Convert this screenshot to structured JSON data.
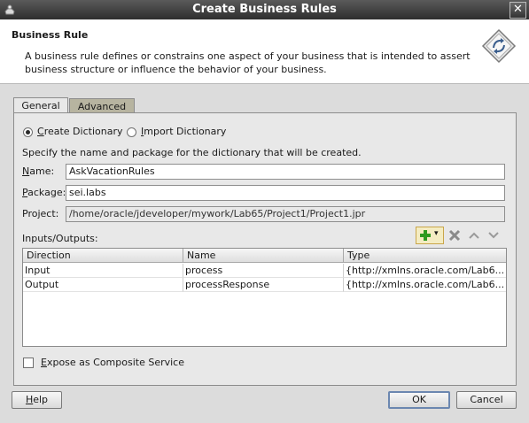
{
  "window": {
    "title": "Create Business Rules",
    "close_label": "✕"
  },
  "header": {
    "title": "Business Rule",
    "description": "A business rule defines or constrains one aspect of your business that is intended to assert business structure or influence the behavior of your business."
  },
  "tabs": [
    {
      "label": "General",
      "active": true
    },
    {
      "label": "Advanced",
      "active": false
    }
  ],
  "dictionary_mode": {
    "create_label": "Create Dictionary",
    "import_label": "Import Dictionary",
    "selected": "create"
  },
  "instructions": "Specify the name and package for the dictionary that will be created.",
  "fields": {
    "name": {
      "label": "Name:",
      "value": "AskVacationRules"
    },
    "package": {
      "label": "Package:",
      "value": "sei.labs"
    },
    "project": {
      "label": "Project:",
      "value": "/home/oracle/jdeveloper/mywork/Lab65/Project1/Project1.jpr"
    }
  },
  "io": {
    "label": "Inputs/Outputs:",
    "columns": [
      "Direction",
      "Name",
      "Type"
    ],
    "rows": [
      {
        "direction": "Input",
        "name": "process",
        "type": "{http://xmlns.oracle.com/Lab6..."
      },
      {
        "direction": "Output",
        "name": "processResponse",
        "type": "{http://xmlns.oracle.com/Lab6..."
      }
    ]
  },
  "expose": {
    "label": "Expose as Composite Service",
    "checked": false
  },
  "buttons": {
    "help": "Help",
    "ok": "OK",
    "cancel": "Cancel"
  },
  "colors": {
    "add_icon": "#2e9a1f",
    "accent_border": "#6b87b0"
  }
}
